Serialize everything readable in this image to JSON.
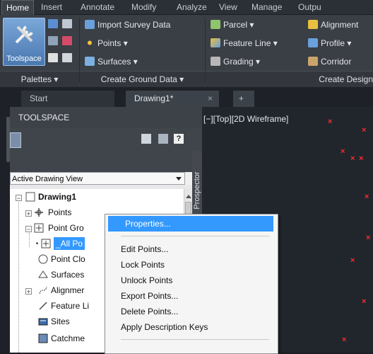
{
  "ribbon_tabs": [
    "Home",
    "Insert",
    "Annotate",
    "Modify",
    "Analyze",
    "View",
    "Manage",
    "Outpu"
  ],
  "ribbon": {
    "toolspace_label": "Toolspace",
    "import_survey_data": "Import Survey Data",
    "points": "Points",
    "surfaces": "Surfaces",
    "parcel": "Parcel",
    "feature_line": "Feature Line",
    "grading": "Grading",
    "alignment": "Alignment",
    "profile": "Profile",
    "corridor": "Corridor",
    "panel_palettes": "Palettes",
    "panel_create_ground": "Create Ground Data",
    "panel_create_design": "Create Design"
  },
  "doc_tabs": {
    "start": "Start",
    "drawing": "Drawing1*",
    "close": "×",
    "new": "+"
  },
  "toolspace": {
    "title": "TOOLSPACE",
    "view_select": "Active Drawing View",
    "prospector": "Prospector",
    "tree": {
      "drawing": "Drawing1",
      "points": "Points",
      "point_groups": "Point Gro",
      "all_points": "_All Po",
      "point_clouds": "Point Clo",
      "surfaces": "Surfaces",
      "alignments": "Alignmer",
      "feature_lines": "Feature Li",
      "sites": "Sites",
      "catchments": "Catchme"
    }
  },
  "viewport": {
    "label": "[−][Top][2D Wireframe]"
  },
  "context_menu": {
    "properties": "Properties...",
    "edit_points": "Edit Points...",
    "lock_points": "Lock Points",
    "unlock_points": "Unlock Points",
    "export_points": "Export Points...",
    "delete_points": "Delete Points...",
    "apply_description_keys": "Apply Description Keys"
  },
  "colors": {
    "highlight": "#3399ff",
    "marker": "#ff2a2a"
  }
}
